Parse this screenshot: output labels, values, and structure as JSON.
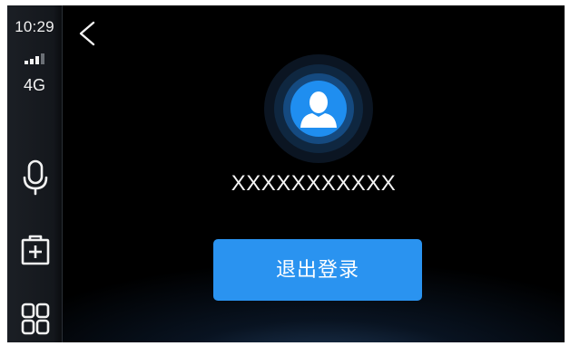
{
  "status": {
    "time": "10:29",
    "network": "4G",
    "signal_bars_active": 3,
    "signal_bars_total": 4
  },
  "dock": {
    "items": [
      {
        "icon": "microphone-icon"
      },
      {
        "icon": "medical-kit-icon"
      },
      {
        "icon": "apps-grid-icon"
      }
    ]
  },
  "header": {
    "back_icon": "chevron-left-icon"
  },
  "profile": {
    "avatar_icon": "user-avatar-icon",
    "username": "XXXXXXXXXXX"
  },
  "actions": {
    "logout_label": "退出登录"
  },
  "colors": {
    "accent": "#2a93f0",
    "background": "#000000",
    "sidebar": "#16191e",
    "text": "#f4f4f4"
  }
}
